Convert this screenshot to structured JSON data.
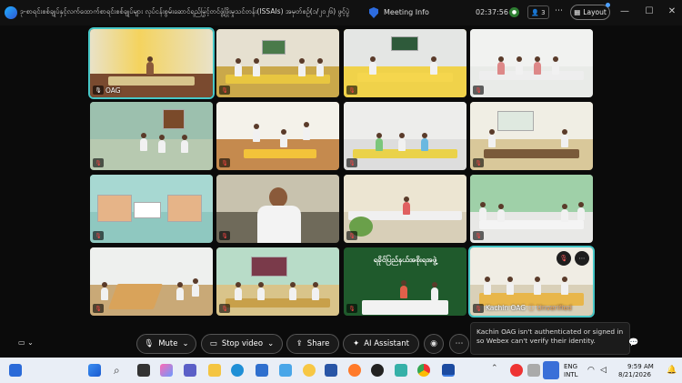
{
  "window": {
    "title": "ဒု-စာရင်းစစ်ချုပ်နှင့်လက်ထောက်စာရင်းစစ်ချုပ်များ လုပ်ငန်းစွမ်းဆောင်ရည်မြှင့်တင်ဖွံ့ဖြိုးမှုသင်တန်း(ISSAIs) အမှတ်စဥ်(၁/၂၀၂၆) ဖွင့်ပွဲ",
    "meeting_info_label": "Meeting Info",
    "timer": "02:37:56",
    "participants_count": "3",
    "layout_label": "Layout",
    "minimize": "—",
    "maximize": "☐",
    "close": "✕"
  },
  "tiles": [
    {
      "name": "OAG",
      "muted": false
    },
    {
      "name": "",
      "muted": true
    },
    {
      "name": "",
      "muted": true
    },
    {
      "name": "",
      "muted": true
    },
    {
      "name": "",
      "muted": true
    },
    {
      "name": "",
      "muted": true
    },
    {
      "name": "",
      "muted": true
    },
    {
      "name": "",
      "muted": true
    },
    {
      "name": "",
      "muted": true
    },
    {
      "name": "",
      "muted": true
    },
    {
      "name": "",
      "muted": true
    },
    {
      "name": "",
      "muted": true
    },
    {
      "name": "",
      "muted": true
    },
    {
      "name": "",
      "muted": true
    },
    {
      "name": "",
      "muted": true
    },
    {
      "name": "Kachin OAG",
      "muted": true
    }
  ],
  "banner_text": "ရခိုင်ပြည်နယ်အစိုးရအဖွဲ့",
  "unverified_label": "Unverified",
  "tooltip": "Kachin OAG isn't authenticated or signed in so Webex can't verify their identity.",
  "controls": {
    "mute_label": "Mute",
    "stop_video_label": "Stop video",
    "share_label": "Share",
    "ai_assistant_label": "AI Assistant"
  },
  "taskbar": {
    "lang_line1": "ENG",
    "lang_line2": "INTL",
    "time": "9:59 AM",
    "date": "8/21/2026"
  },
  "colors": {
    "active_tile_border": "#46c7c7",
    "unverified": "#f0a65a",
    "muted_icon": "#ff5b5b"
  }
}
